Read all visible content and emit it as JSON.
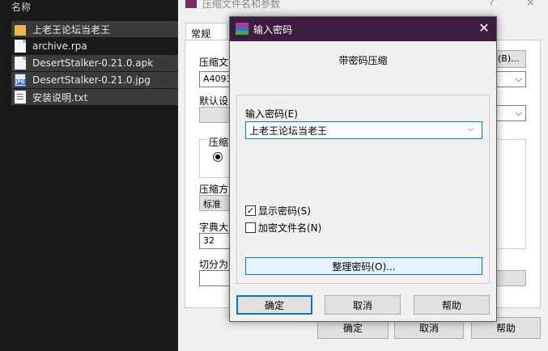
{
  "explorer": {
    "column_header": "名称",
    "files": [
      {
        "name": "上老王论坛当老王",
        "icon": "folder-icon",
        "selected": true
      },
      {
        "name": "archive.rpa",
        "icon": "file-icon",
        "selected": false
      },
      {
        "name": "DesertStalker-0.21.0.apk",
        "icon": "file-icon",
        "selected": true
      },
      {
        "name": "DesertStalker-0.21.0.jpg",
        "icon": "image-file-icon",
        "selected": true
      },
      {
        "name": "安装说明.txt",
        "icon": "text-file-icon",
        "selected": true
      }
    ]
  },
  "archive_dialog": {
    "title": "压缩文件名和参数",
    "help": "?",
    "close": "×",
    "tab_general": "常规",
    "archive_name_label": "压缩文",
    "archive_name_value": "A4093",
    "browse_button": "(B)...",
    "default_profile_label": "默认设",
    "format_group_label": "压缩",
    "method_label": "压缩方",
    "method_value": "标准",
    "dict_label": "字典大",
    "dict_value": "32",
    "split_label": "切分为",
    "ok": "确定",
    "cancel": "取消",
    "help_button": "帮助"
  },
  "password_dialog": {
    "title": "输入密码",
    "close": "✕",
    "heading": "带密码压缩",
    "password_label": "输入密码(E)",
    "password_value": "上老王论坛当老王",
    "show_password_label": "显示密码(S)",
    "show_password_checked": true,
    "encrypt_names_label": "加密文件名(N)",
    "encrypt_names_checked": false,
    "manage_button": "整理密码(O)...",
    "ok": "确定",
    "cancel": "取消",
    "help": "帮助"
  },
  "colors": {
    "title_bar": "#3c1d40",
    "accent": "#0078d7",
    "explorer_bg": "#191919"
  }
}
